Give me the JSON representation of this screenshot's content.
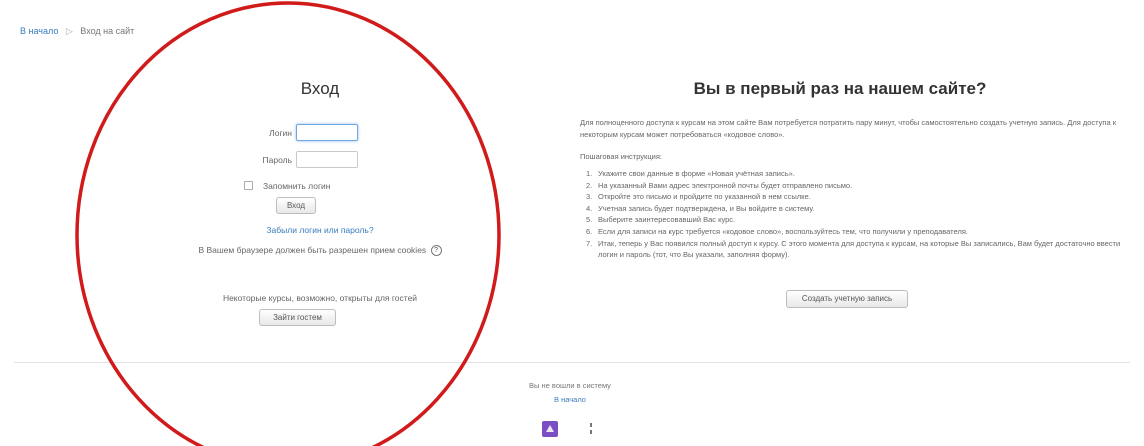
{
  "breadcrumb": {
    "home": "В начало",
    "separator": "▷",
    "current": "Вход на сайт"
  },
  "login": {
    "title": "Вход",
    "username_label": "Логин",
    "username_value": "",
    "password_label": "Пароль",
    "password_value": "",
    "remember_label": "Запомнить логин",
    "submit_label": "Вход",
    "forgot_link": "Забыли логин или пароль?",
    "cookies_note": "В Вашем браузере должен быть разрешен прием cookies",
    "help_icon": "?",
    "guest_note": "Некоторые курсы, возможно, открыты для гостей",
    "guest_button": "Зайти гостем"
  },
  "signup": {
    "title": "Вы в первый раз на нашем сайте?",
    "intro": "Для полноценного доступа к курсам на этом сайте Вам потребуется потратить пару минут, чтобы самостоятельно создать учетную запись. Для доступа к некоторым курсам может потребоваться «кодовое слово».",
    "instructions_heading": "Пошаговая инструкция:",
    "steps": [
      {
        "num": "1.",
        "text": "Укажите свои данные в форме «Новая учётная запись»."
      },
      {
        "num": "2.",
        "text": "На указанный Вами адрес электронной почты будет отправлено письмо."
      },
      {
        "num": "3.",
        "text": "Откройте это письмо и пройдите по указанной в нем ссылке."
      },
      {
        "num": "4.",
        "text": "Учетная запись будет подтверждена, и Вы войдите в систему."
      },
      {
        "num": "5.",
        "text": "Выберите заинтересовавший Вас курс."
      },
      {
        "num": "6.",
        "text": "Если для записи на курс требуется «кодовое слово», воспользуйтесь тем, что получили у преподавателя."
      },
      {
        "num": "7.",
        "text": "Итак, теперь у Вас появился полный доступ к курсу. С этого момента для доступа к курсам, на которые Вы записались, Вам будет достаточно ввести логин и пароль (тот, что Вы указали, заполняя форму)."
      }
    ],
    "create_button": "Создать учетную запись"
  },
  "footer": {
    "status": "Вы не вошли в систему",
    "home_link": "В начало"
  },
  "colors": {
    "annotation_circle": "#d11a1a",
    "link": "#3a7bbf",
    "focus": "#6fa7e0"
  }
}
